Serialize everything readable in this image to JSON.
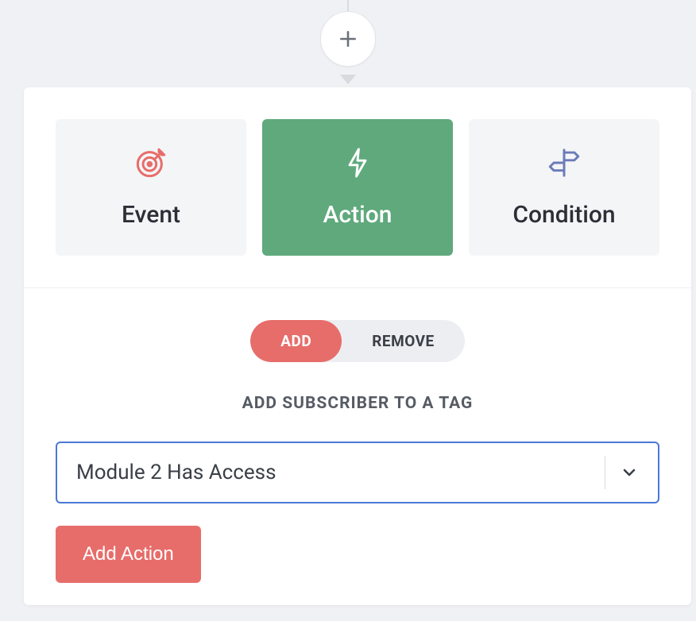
{
  "plus_icon_name": "plus-icon",
  "types": {
    "event": {
      "label": "Event"
    },
    "action": {
      "label": "Action"
    },
    "condition": {
      "label": "Condition"
    }
  },
  "toggle": {
    "add": "ADD",
    "remove": "REMOVE"
  },
  "config": {
    "heading": "ADD SUBSCRIBER TO A TAG",
    "selected_tag": "Module 2 Has Access",
    "submit_label": "Add Action"
  },
  "colors": {
    "accent_red": "#e76d6a",
    "accent_green": "#5fa97d",
    "accent_blue": "#4a78d6",
    "icon_blue": "#6a7bb8"
  }
}
